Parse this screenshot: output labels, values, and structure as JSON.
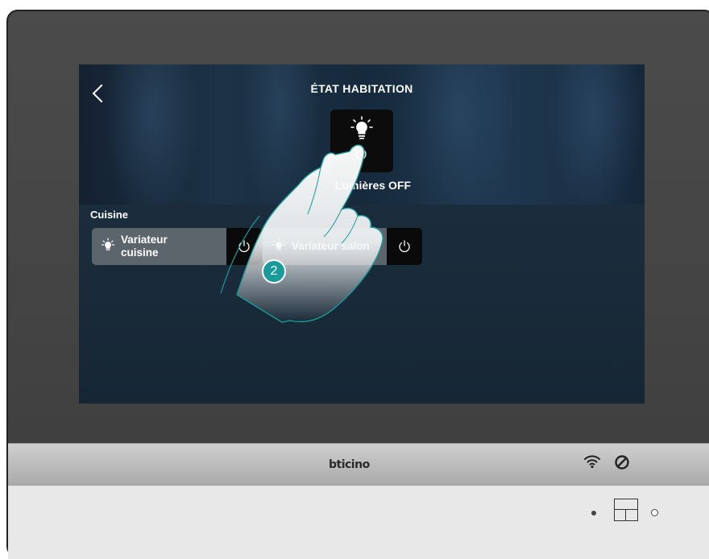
{
  "screen": {
    "title": "ÉTAT HABITATION",
    "scene": {
      "label": "Lumières OFF",
      "icon": "light-bulb-icon",
      "action_icon": "power-icon"
    },
    "room": {
      "name": "Cuisine",
      "devices": [
        {
          "label": "Variateur cuisine",
          "line1": "Variateur",
          "line2": "cuisine",
          "icon": "dimmer-light-icon",
          "action_icon": "power-icon"
        },
        {
          "label": "Variateur salon",
          "icon": "dimmer-light-icon",
          "action_icon": "power-icon"
        }
      ]
    }
  },
  "annotation": {
    "step": "2"
  },
  "device": {
    "brand": "bticino",
    "status_icons": [
      "wifi-icon",
      "do-not-disturb-icon"
    ]
  },
  "colors": {
    "accent": "#1a9a9a",
    "panel": "#5c646c",
    "button": "#0a0a0a"
  }
}
